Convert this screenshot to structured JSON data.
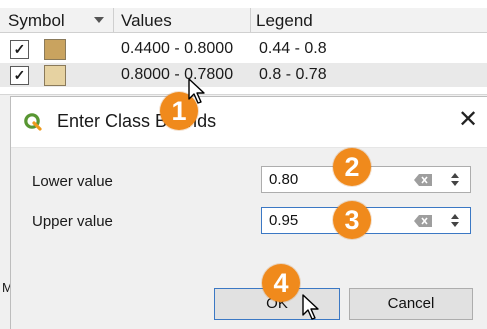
{
  "table": {
    "headers": {
      "symbol": "Symbol",
      "values": "Values",
      "legend": "Legend"
    },
    "rows": [
      {
        "checked": "✓",
        "swatch_color": "#c9a35f",
        "values": "0.4400 - 0.8000",
        "legend": "0.44 - 0.8"
      },
      {
        "checked": "✓",
        "swatch_color": "#e6d2a1",
        "values": "0.8000 - 0.7800",
        "legend": "0.8 - 0.78"
      }
    ]
  },
  "dialog": {
    "title": "Enter Class Bounds",
    "close_icon": "close-icon",
    "lower_label": "Lower value",
    "lower_value": "0.80",
    "upper_label": "Upper value",
    "upper_value": "0.95",
    "ok_label": "OK",
    "cancel_label": "Cancel"
  },
  "annotations": {
    "badges": [
      "1",
      "2",
      "3",
      "4"
    ],
    "badge_color": "#f08a1c"
  },
  "side_letter": "M"
}
